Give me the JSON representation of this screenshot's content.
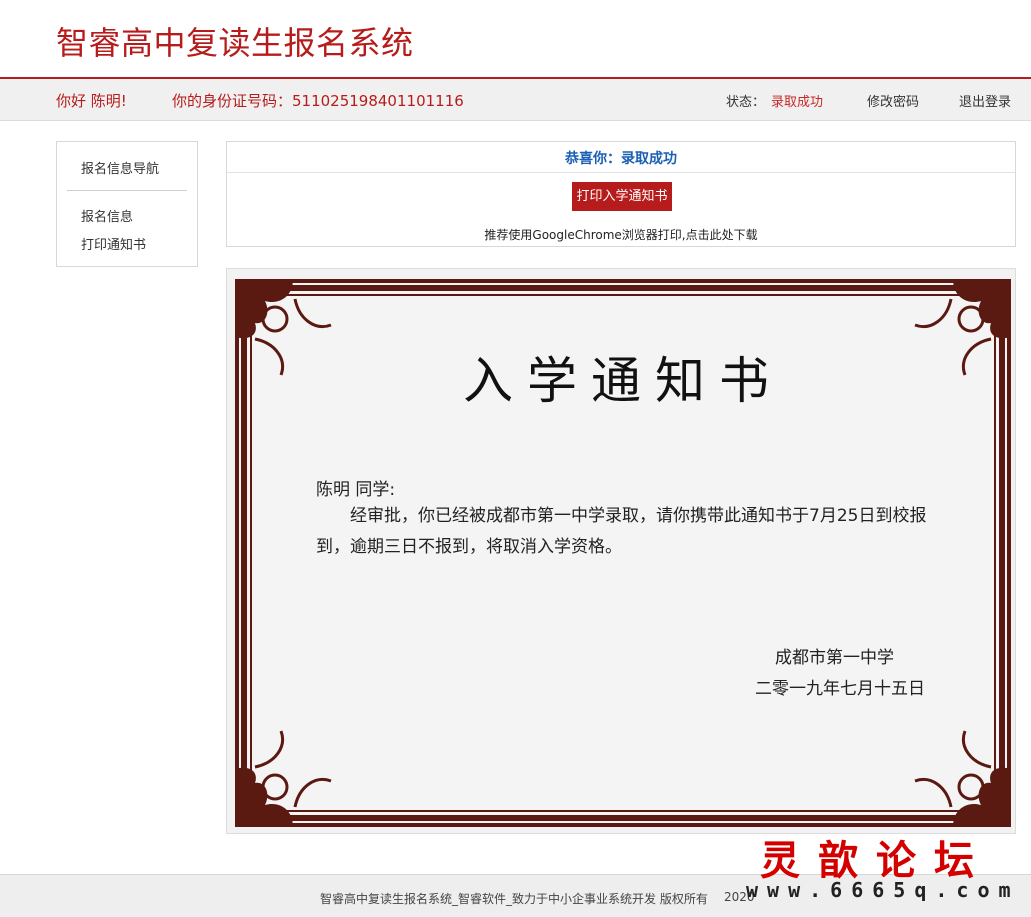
{
  "header": {
    "title": "智睿高中复读生报名系统"
  },
  "infobar": {
    "greeting": "你好 陈明!",
    "id_label_value": "你的身份证号码：511025198401101116",
    "status_label": "状态：",
    "status_value": "录取成功",
    "change_password": "修改密码",
    "logout": "退出登录"
  },
  "sidebar": {
    "title": "报名信息导航",
    "items": [
      {
        "label": "报名信息"
      },
      {
        "label": "打印通知书"
      }
    ]
  },
  "panel": {
    "congrats": "恭喜你：录取成功",
    "print_button": "打印入学通知书",
    "hint": "推荐使用GoogleChrome浏览器打印,点击此处下载"
  },
  "certificate": {
    "title": "入学通知书",
    "salutation": "陈明 同学:",
    "body": "经审批，你已经被成都市第一中学录取，请你携带此通知书于7月25日到校报到，逾期三日不报到，将取消入学资格。",
    "school": "成都市第一中学",
    "date": "二零一九年七月十五日"
  },
  "footer": {
    "copyright": "智睿高中复读生报名系统_智睿软件_致力于中小企事业系统开发  版权所有",
    "year": "2020"
  },
  "watermark": {
    "title": "灵歆论坛",
    "url": "www.6665q.com"
  },
  "colors": {
    "brand_red": "#b71c1c",
    "link_blue": "#1a5fb4",
    "frame_brown": "#5a1a12"
  }
}
